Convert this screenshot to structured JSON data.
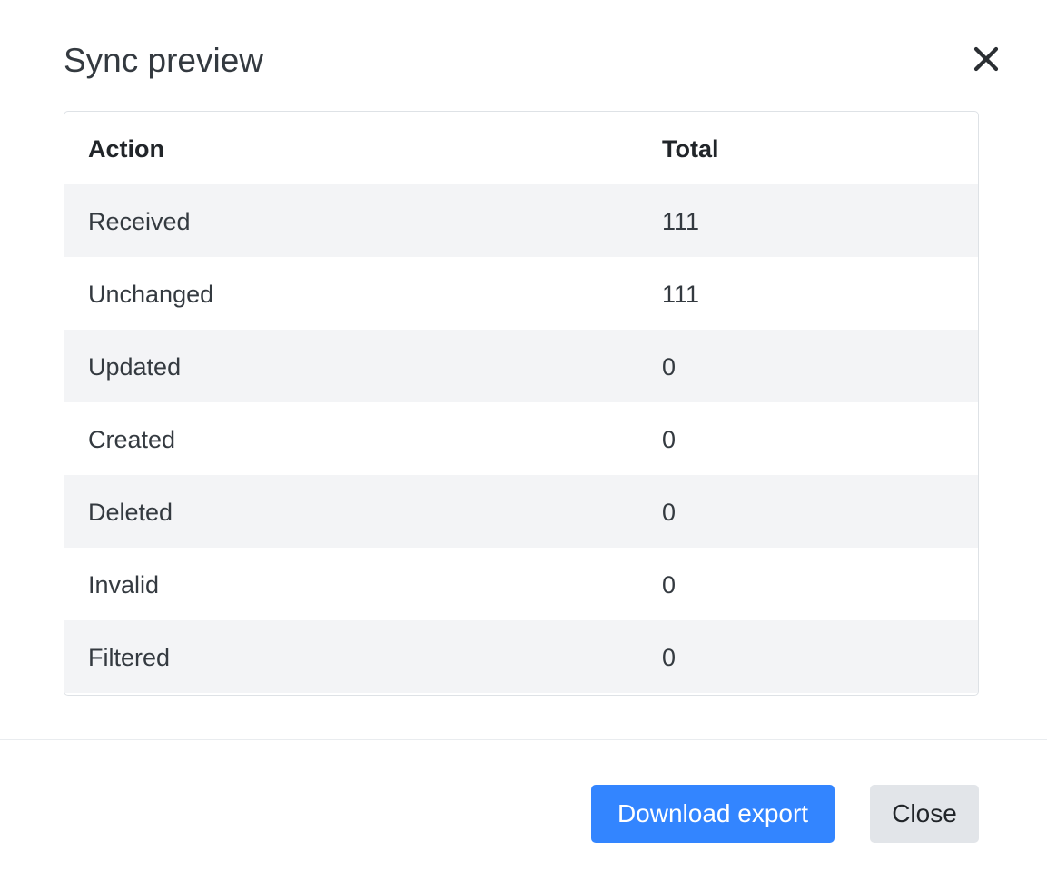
{
  "modal": {
    "title": "Sync preview",
    "close_icon": "close-x-icon"
  },
  "table": {
    "columns": [
      "Action",
      "Total"
    ],
    "rows": [
      {
        "action": "Received",
        "total": "111"
      },
      {
        "action": "Unchanged",
        "total": "111"
      },
      {
        "action": "Updated",
        "total": "0"
      },
      {
        "action": "Created",
        "total": "0"
      },
      {
        "action": "Deleted",
        "total": "0"
      },
      {
        "action": "Invalid",
        "total": "0"
      },
      {
        "action": "Filtered",
        "total": "0"
      }
    ]
  },
  "footer": {
    "download_label": "Download export",
    "close_label": "Close"
  },
  "colors": {
    "primary": "#3385ff",
    "secondary": "#e2e5e9",
    "stripe": "#f3f4f6",
    "border": "#dee2e6"
  }
}
